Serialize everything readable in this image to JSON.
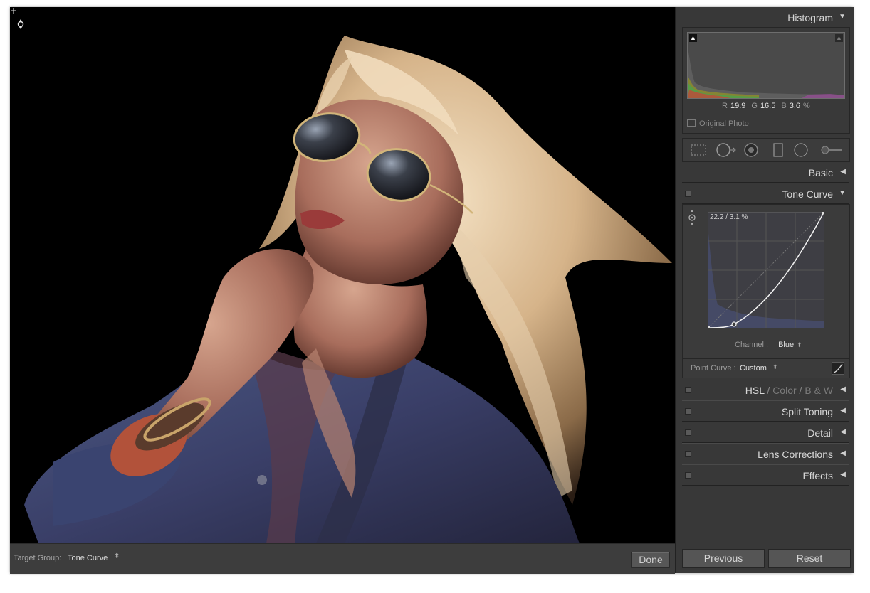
{
  "bottom_bar": {
    "target_group_label": "Target Group:",
    "target_group_value": "Tone Curve",
    "done_label": "Done"
  },
  "panels": {
    "histogram": {
      "title": "Histogram",
      "r_label": "R",
      "r_value": "19.9",
      "g_label": "G",
      "g_value": "16.5",
      "b_label": "B",
      "b_value": "3.6",
      "percent": "%",
      "original_photo_label": "Original Photo"
    },
    "basic": {
      "title": "Basic"
    },
    "tone_curve": {
      "title": "Tone Curve",
      "readout": "22.2 / 3.1 %",
      "channel_label": "Channel :",
      "channel_value": "Blue",
      "point_curve_label": "Point Curve :",
      "point_curve_value": "Custom"
    },
    "hsl": {
      "hsl": "HSL",
      "sep": "/",
      "color": "Color",
      "bw": "B & W"
    },
    "split_toning": {
      "title": "Split Toning"
    },
    "detail": {
      "title": "Detail"
    },
    "lens_corrections": {
      "title": "Lens Corrections"
    },
    "effects": {
      "title": "Effects"
    }
  },
  "buttons": {
    "previous": "Previous",
    "reset": "Reset"
  },
  "icons": [
    "collapse-triangle-icon",
    "expand-triangle-icon",
    "crop-overlay-icon",
    "spot-removal-icon",
    "red-eye-icon",
    "graduated-filter-icon",
    "radial-filter-icon",
    "adjustment-brush-icon",
    "targeted-adjustment-icon",
    "point-curve-edit-icon"
  ]
}
